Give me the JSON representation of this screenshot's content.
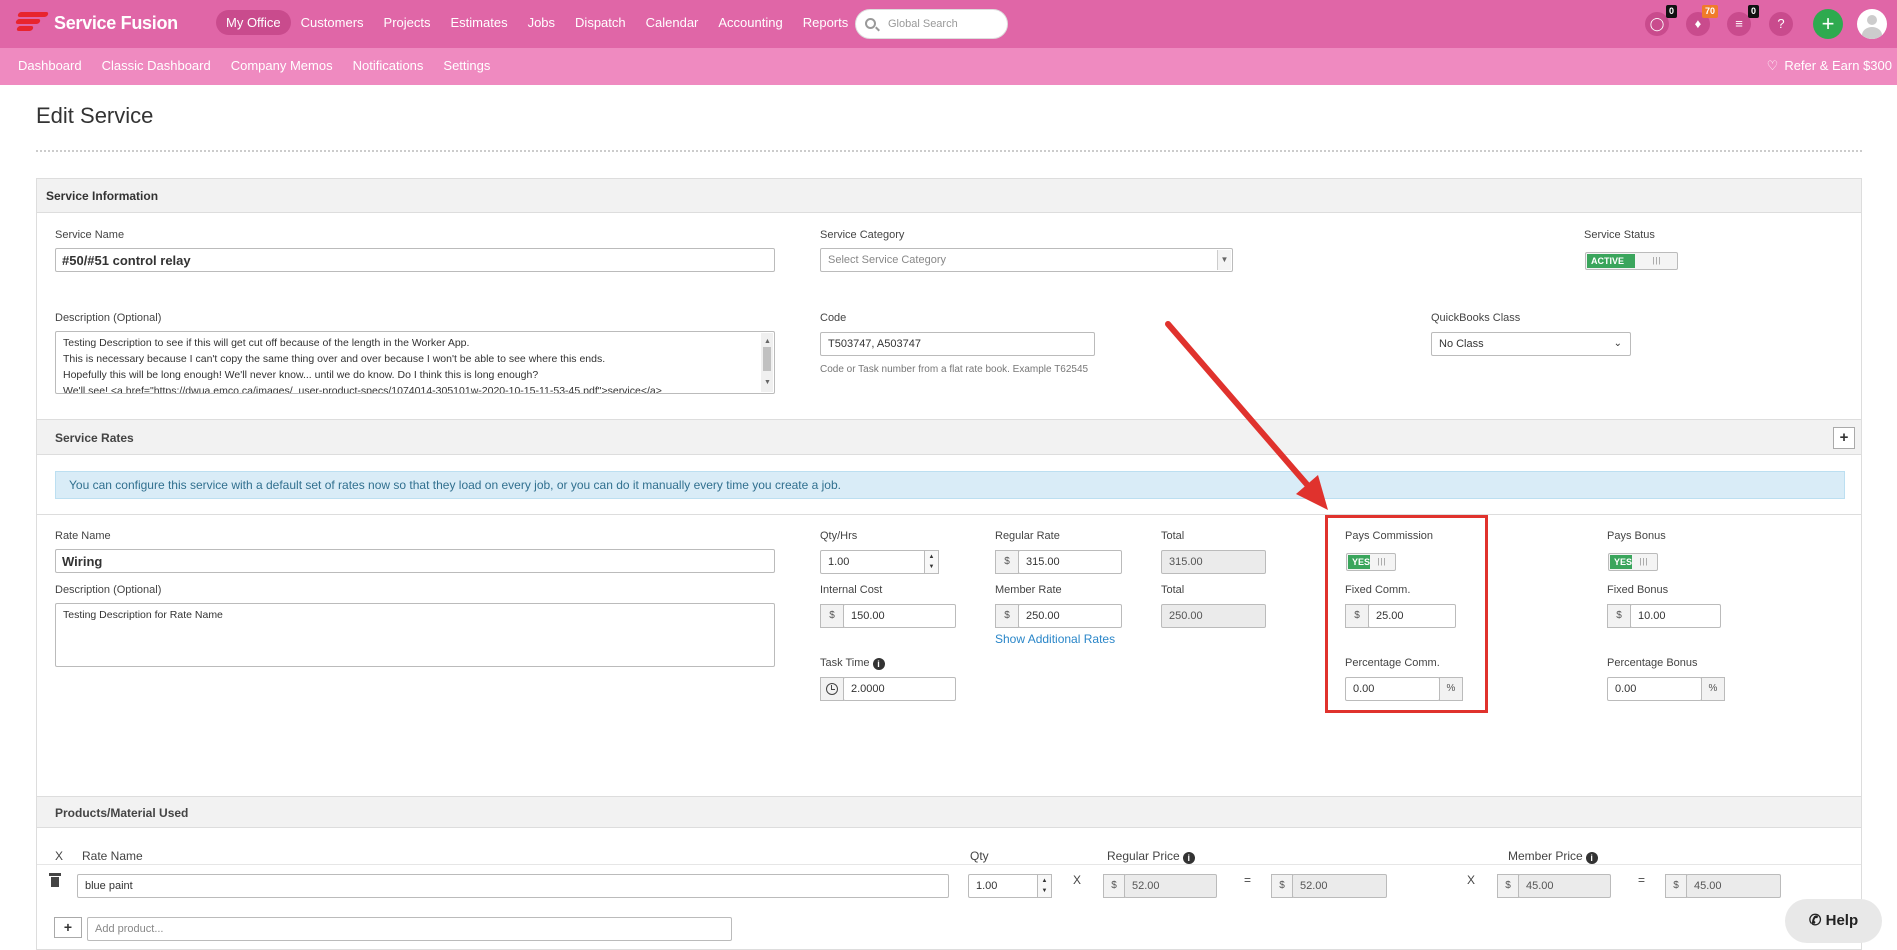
{
  "app": {
    "name": "Service Fusion"
  },
  "nav": {
    "main": [
      "My Office",
      "Customers",
      "Projects",
      "Estimates",
      "Jobs",
      "Dispatch",
      "Calendar",
      "Accounting",
      "Reports"
    ],
    "search_placeholder": "Global Search",
    "chat_badge": "0",
    "notifications_badge": "70",
    "tasks_badge": "0",
    "help_glyph": "?",
    "add_glyph": "+"
  },
  "subnav": {
    "items": [
      "Dashboard",
      "Classic Dashboard",
      "Company Memos",
      "Notifications",
      "Settings"
    ],
    "refer": "Refer & Earn $300"
  },
  "page": {
    "title": "Edit Service"
  },
  "service_info": {
    "section_title": "Service Information",
    "name_label": "Service Name",
    "name_value": "#50/#51 control relay",
    "category_label": "Service Category",
    "category_placeholder": "Select Service Category",
    "status_label": "Service Status",
    "status_value": "ACTIVE",
    "description_label": "Description (Optional)",
    "description_lines": [
      "Testing Description to see if this will get cut off because of the length in the Worker App.",
      "This is necessary because I can't copy the same thing over and over because I won't be able to see where this ends.",
      "Hopefully this will be long enough! We'll never know... until we do know. Do I think this is long enough?",
      "We'll see! <a href=\"https://dwua.emco.ca/images/_user-product-specs/1074014-305101w-2020-10-15-11-53-45.pdf\">service</a>"
    ],
    "code_label": "Code",
    "code_value": "T503747, A503747",
    "code_hint": "Code or Task number from a flat rate book. Example T62545",
    "qb_label": "QuickBooks Class",
    "qb_value": "No Class"
  },
  "rates": {
    "section_title": "Service Rates",
    "add_glyph": "+",
    "info": "You can configure this service with a default set of rates now so that they load on every job, or you can do it manually every time you create a job.",
    "rate_name_label": "Rate Name",
    "rate_name_value": "Wiring",
    "desc_label": "Description (Optional)",
    "desc_value": "Testing Description for Rate Name",
    "qty_label": "Qty/Hrs",
    "qty_value": "1.00",
    "internal_cost_label": "Internal Cost",
    "internal_cost_value": "150.00",
    "task_time_label": "Task Time",
    "task_time_value": "2.0000",
    "regular_rate_label": "Regular Rate",
    "regular_rate_value": "315.00",
    "member_rate_label": "Member Rate",
    "member_rate_value": "250.00",
    "additional_rates_link": "Show Additional Rates",
    "total_label": "Total",
    "total_regular": "315.00",
    "total_member": "250.00",
    "pays_commission_label": "Pays Commission",
    "pays_commission_value": "YES",
    "fixed_comm_label": "Fixed Comm.",
    "fixed_comm_value": "25.00",
    "pct_comm_label": "Percentage Comm.",
    "pct_comm_value": "0.00",
    "pays_bonus_label": "Pays Bonus",
    "pays_bonus_value": "YES",
    "fixed_bonus_label": "Fixed Bonus",
    "fixed_bonus_value": "10.00",
    "pct_bonus_label": "Percentage Bonus",
    "pct_bonus_value": "0.00",
    "currency": "$",
    "percent": "%",
    "info_glyph": "i"
  },
  "products": {
    "section_title": "Products/Material Used",
    "headers": {
      "x": "X",
      "rate_name": "Rate Name",
      "qty": "Qty",
      "regular_price": "Regular Price",
      "member_price": "Member Price"
    },
    "rows": [
      {
        "name": "blue paint",
        "qty": "1.00",
        "regular_price": "52.00",
        "regular_total": "52.00",
        "member_price": "45.00",
        "member_total": "45.00"
      }
    ],
    "op_x": "X",
    "op_eq": "=",
    "add_glyph": "+",
    "add_placeholder": "Add product..."
  },
  "help": {
    "label": "Help"
  },
  "colors": {
    "topbar": "#e066a7",
    "subbar": "#ef8ac0",
    "active_nav": "#c94b8d",
    "toggle_on": "#3aa55c",
    "annotation": "#e0322d",
    "info_bg": "#d9ecf7"
  }
}
